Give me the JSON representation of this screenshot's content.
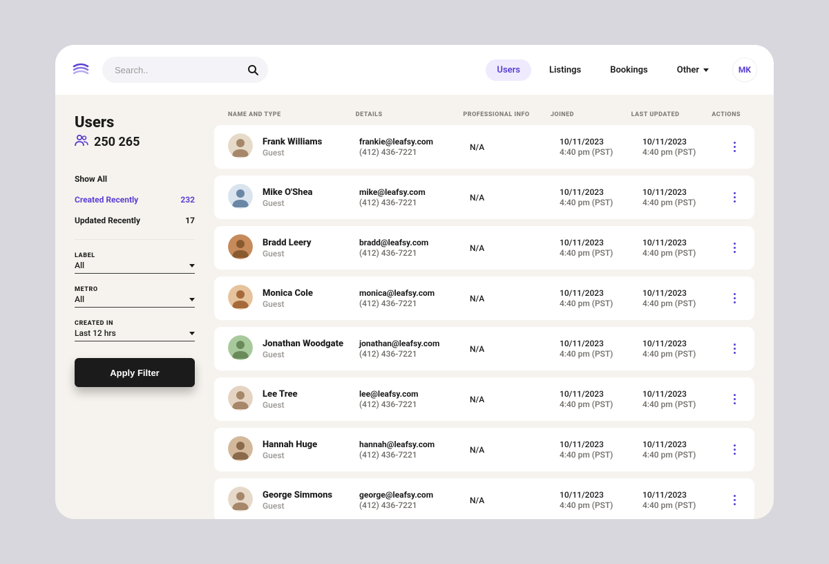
{
  "header": {
    "search_placeholder": "Search..",
    "nav": {
      "users": "Users",
      "listings": "Listings",
      "bookings": "Bookings",
      "other": "Other"
    },
    "avatar_initials": "MK"
  },
  "sidebar": {
    "title": "Users",
    "count": "250 265",
    "filters": {
      "show_all": "Show All",
      "created_recently": {
        "label": "Created Recently",
        "count": "232"
      },
      "updated_recently": {
        "label": "Updated Recently",
        "count": "17"
      }
    },
    "fields": {
      "label": {
        "label": "LABEL",
        "value": "All"
      },
      "metro": {
        "label": "METRO",
        "value": "All"
      },
      "created_in": {
        "label": "CREATED IN",
        "value": "Last 12 hrs"
      }
    },
    "apply_label": "Apply Filter"
  },
  "table": {
    "headers": {
      "name": "NAME AND TYPE",
      "details": "DETAILS",
      "professional": "PROFESSIONAL INFO",
      "joined": "JOINED",
      "updated": "LAST UPDATED",
      "actions": "ACTIONS"
    },
    "rows": [
      {
        "name": "Frank Williams",
        "type": "Guest",
        "email": "frankie@leafsy.com",
        "phone": "(412) 436-7221",
        "professional": "N/A",
        "joined_date": "10/11/2023",
        "joined_time": "4:40 pm (PST)",
        "updated_date": "10/11/2023",
        "updated_time": "4:40 pm (PST)",
        "avatar_bg": "#e6dac9",
        "avatar_color": "#a6876a"
      },
      {
        "name": "Mike O'Shea",
        "type": "Guest",
        "email": "mike@leafsy.com",
        "phone": "(412) 436-7221",
        "professional": "N/A",
        "joined_date": "10/11/2023",
        "joined_time": "4:40 pm (PST)",
        "updated_date": "10/11/2023",
        "updated_time": "4:40 pm (PST)",
        "avatar_bg": "#d9e4ef",
        "avatar_color": "#6a87a6"
      },
      {
        "name": "Bradd Leery",
        "type": "Guest",
        "email": "bradd@leafsy.com",
        "phone": "(412) 436-7221",
        "professional": "N/A",
        "joined_date": "10/11/2023",
        "joined_time": "4:40 pm (PST)",
        "updated_date": "10/11/2023",
        "updated_time": "4:40 pm (PST)",
        "avatar_bg": "#c78a5a",
        "avatar_color": "#8a5a2f"
      },
      {
        "name": "Monica Cole",
        "type": "Guest",
        "email": "monica@leafsy.com",
        "phone": "(412) 436-7221",
        "professional": "N/A",
        "joined_date": "10/11/2023",
        "joined_time": "4:40 pm (PST)",
        "updated_date": "10/11/2023",
        "updated_time": "4:40 pm (PST)",
        "avatar_bg": "#e6c39c",
        "avatar_color": "#a66a3a"
      },
      {
        "name": "Jonathan Woodgate",
        "type": "Guest",
        "email": "jonathan@leafsy.com",
        "phone": "(412) 436-7221",
        "professional": "N/A",
        "joined_date": "10/11/2023",
        "joined_time": "4:40 pm (PST)",
        "updated_date": "10/11/2023",
        "updated_time": "4:40 pm (PST)",
        "avatar_bg": "#a8c99c",
        "avatar_color": "#6a8a5a"
      },
      {
        "name": "Lee Tree",
        "type": "Guest",
        "email": "lee@leafsy.com",
        "phone": "(412) 436-7221",
        "professional": "N/A",
        "joined_date": "10/11/2023",
        "joined_time": "4:40 pm (PST)",
        "updated_date": "10/11/2023",
        "updated_time": "4:40 pm (PST)",
        "avatar_bg": "#e6d4c3",
        "avatar_color": "#a6876a"
      },
      {
        "name": "Hannah Huge",
        "type": "Guest",
        "email": "hannah@leafsy.com",
        "phone": "(412) 436-7221",
        "professional": "N/A",
        "joined_date": "10/11/2023",
        "joined_time": "4:40 pm (PST)",
        "updated_date": "10/11/2023",
        "updated_time": "4:40 pm (PST)",
        "avatar_bg": "#d4b89c",
        "avatar_color": "#8a6a4a"
      },
      {
        "name": "George Simmons",
        "type": "Guest",
        "email": "george@leafsy.com",
        "phone": "(412) 436-7221",
        "professional": "N/A",
        "joined_date": "10/11/2023",
        "joined_time": "4:40 pm (PST)",
        "updated_date": "10/11/2023",
        "updated_time": "4:40 pm (PST)",
        "avatar_bg": "#e6d9c9",
        "avatar_color": "#a6876a"
      }
    ]
  }
}
